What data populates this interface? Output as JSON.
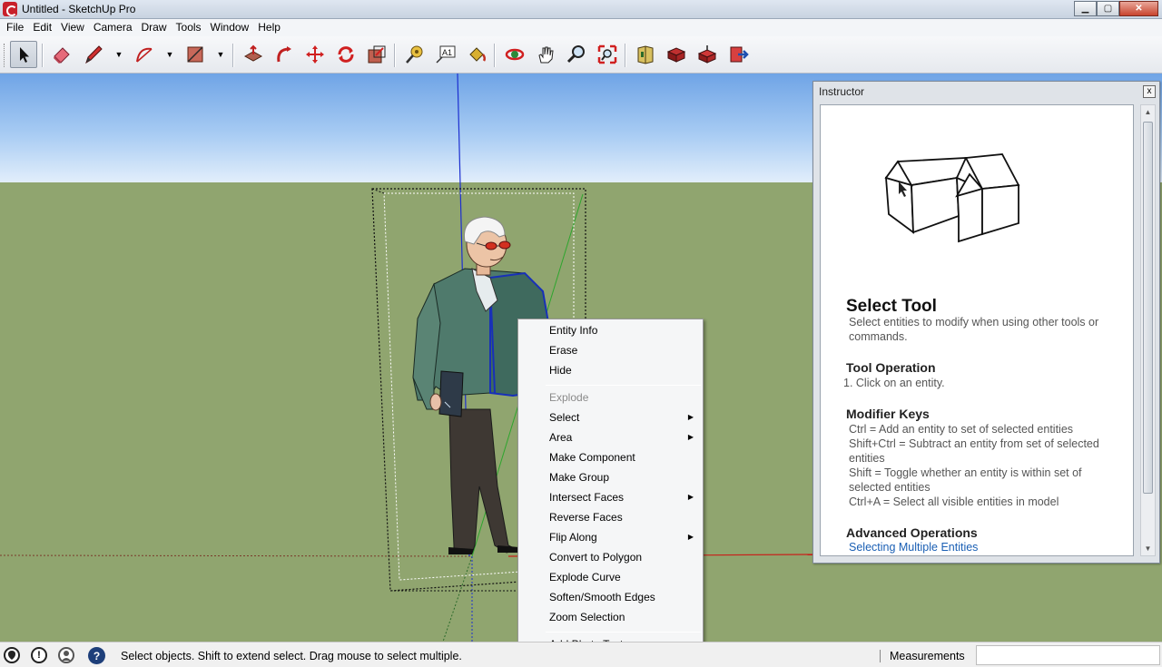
{
  "window": {
    "title": "Untitled - SketchUp Pro",
    "controls": {
      "minimize": "▁",
      "maximize": "▢",
      "close": "✕"
    }
  },
  "menubar": {
    "items": [
      "File",
      "Edit",
      "View",
      "Camera",
      "Draw",
      "Tools",
      "Window",
      "Help"
    ]
  },
  "toolbar": {
    "tools": [
      {
        "name": "select-tool",
        "icon": "arrow-cursor-icon",
        "active": true
      },
      {
        "name": "eraser-tool",
        "icon": "eraser-icon"
      },
      {
        "name": "pencil-tool",
        "icon": "pencil-icon"
      },
      {
        "name": "arc-tool",
        "icon": "arc-icon"
      },
      {
        "name": "rectangle-tool",
        "icon": "rectangle-icon"
      },
      {
        "name": "push-pull-tool",
        "icon": "push-pull-icon"
      },
      {
        "name": "follow-me-tool",
        "icon": "follow-me-icon"
      },
      {
        "name": "move-tool",
        "icon": "move-icon"
      },
      {
        "name": "rotate-tool",
        "icon": "rotate-icon"
      },
      {
        "name": "scale-tool",
        "icon": "scale-icon"
      },
      {
        "name": "tape-measure-tool",
        "icon": "tape-measure-icon"
      },
      {
        "name": "text-tool",
        "icon": "text-icon"
      },
      {
        "name": "paint-bucket-tool",
        "icon": "paint-bucket-icon"
      },
      {
        "name": "orbit-tool",
        "icon": "orbit-icon"
      },
      {
        "name": "pan-tool",
        "icon": "hand-icon"
      },
      {
        "name": "zoom-tool",
        "icon": "magnifier-icon"
      },
      {
        "name": "zoom-extents-tool",
        "icon": "zoom-extents-icon"
      },
      {
        "name": "warehouse-tool",
        "icon": "warehouse-icon"
      },
      {
        "name": "get-models-tool",
        "icon": "get-models-icon"
      },
      {
        "name": "share-model-tool",
        "icon": "share-model-icon"
      },
      {
        "name": "extension-warehouse-tool",
        "icon": "extension-warehouse-icon"
      }
    ],
    "text_tool_label": "A1"
  },
  "instructor": {
    "header": "Instructor",
    "close": "x",
    "title": "Select Tool",
    "description": "Select entities to modify when using other tools or commands.",
    "tool_operation_heading": "Tool Operation",
    "tool_operation_step": "1.   Click on an entity.",
    "modifier_keys_heading": "Modifier Keys",
    "modifier_keys": [
      "Ctrl = Add an entity to set of selected entities",
      "Shift+Ctrl = Subtract an entity from set of selected entities",
      "Shift = Toggle whether an entity is within set of selected entities",
      "Ctrl+A = Select all visible entities in model"
    ],
    "advanced_heading": "Advanced Operations",
    "advanced_link": "Selecting Multiple Entities"
  },
  "context_menu": {
    "items": [
      {
        "label": "Entity Info",
        "disabled": false,
        "submenu": false
      },
      {
        "label": "Erase",
        "disabled": false,
        "submenu": false
      },
      {
        "label": "Hide",
        "disabled": false,
        "submenu": false
      },
      {
        "label": "Explode",
        "disabled": true,
        "submenu": false
      },
      {
        "label": "Select",
        "disabled": false,
        "submenu": true
      },
      {
        "label": "Area",
        "disabled": false,
        "submenu": true
      },
      {
        "label": "Make Component",
        "disabled": false,
        "submenu": false
      },
      {
        "label": "Make Group",
        "disabled": false,
        "submenu": false
      },
      {
        "label": "Intersect Faces",
        "disabled": false,
        "submenu": true
      },
      {
        "label": "Reverse Faces",
        "disabled": false,
        "submenu": false
      },
      {
        "label": "Flip Along",
        "disabled": false,
        "submenu": true
      },
      {
        "label": "Convert to Polygon",
        "disabled": false,
        "submenu": false
      },
      {
        "label": "Explode Curve",
        "disabled": false,
        "submenu": false
      },
      {
        "label": "Soften/Smooth Edges",
        "disabled": false,
        "submenu": false
      },
      {
        "label": "Zoom Selection",
        "disabled": false,
        "submenu": false
      },
      {
        "label": "Add Photo Texture",
        "disabled": false,
        "submenu": false
      }
    ],
    "submenu_arrow": "▶"
  },
  "statusbar": {
    "text": "Select objects. Shift to extend select. Drag mouse to select multiple.",
    "help_icon": "?",
    "info_icon": "!",
    "measurements_label": "Measurements",
    "measurements_value": ""
  },
  "colors": {
    "sky_top": "#6fa4e6",
    "ground": "#90a56f",
    "axis_blue": "#1d2fd0",
    "axis_green": "#2ea52e",
    "axis_red": "#c8201a",
    "link": "#1a5fb4"
  }
}
